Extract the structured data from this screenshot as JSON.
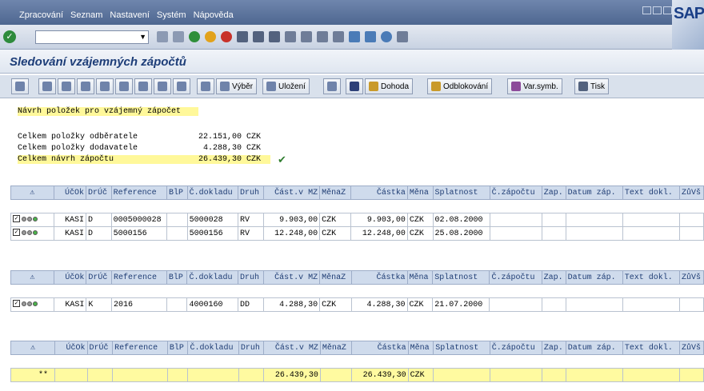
{
  "menu": [
    "Zpracování",
    "Seznam",
    "Nastavení",
    "Systém",
    "Nápověda"
  ],
  "brand": "SAP",
  "title": "Sledování vzájemných zápočtů",
  "toolbar": {
    "vyber": "Výběr",
    "ulozeni": "Uložení",
    "dohoda": "Dohoda",
    "odblokovani": "Odblokování",
    "varsymb": "Var.symb.",
    "tisk": "Tisk"
  },
  "summary": {
    "heading": "Návrh položek pro vzájemný zápočet",
    "rows": [
      {
        "label": "Celkem položky odběratele",
        "amount": "22.151,00",
        "cur": "CZK"
      },
      {
        "label": "Celkem položky dodavatele",
        "amount": "4.288,30",
        "cur": "CZK"
      },
      {
        "label": "Celkem návrh zápočtu",
        "amount": "26.439,30",
        "cur": "CZK"
      }
    ]
  },
  "columns": [
    "",
    "ÚčOk",
    "DrÚč",
    "Reference",
    "BlP",
    "Č.dokladu",
    "Druh",
    "Část.v MZ",
    "MěnaZ",
    "Částka",
    "Měna",
    "Splatnost",
    "Č.zápočtu",
    "Zap.",
    "Datum záp.",
    "Text dokl.",
    "ZůVš"
  ],
  "warn_icon": "⚠",
  "table1": [
    {
      "ucok": "KASI",
      "druc": "D",
      "ref": "0005000028",
      "doc": "5000028",
      "druh": "RV",
      "cast": "9.903,00",
      "menaz": "CZK",
      "castka": "9.903,00",
      "mena": "CZK",
      "splat": "02.08.2000"
    },
    {
      "ucok": "KASI",
      "druc": "D",
      "ref": "5000156",
      "doc": "5000156",
      "druh": "RV",
      "cast": "12.248,00",
      "menaz": "CZK",
      "castka": "12.248,00",
      "mena": "CZK",
      "splat": "25.08.2000"
    }
  ],
  "table2": [
    {
      "ucok": "KASI",
      "druc": "K",
      "ref": "2016",
      "doc": "4000160",
      "druh": "DD",
      "cast": "4.288,30",
      "menaz": "CZK",
      "castka": "4.288,30",
      "mena": "CZK",
      "splat": "21.07.2000"
    }
  ],
  "table3": {
    "mark": "**",
    "cast": "26.439,30",
    "castka": "26.439,30",
    "mena": "CZK"
  }
}
